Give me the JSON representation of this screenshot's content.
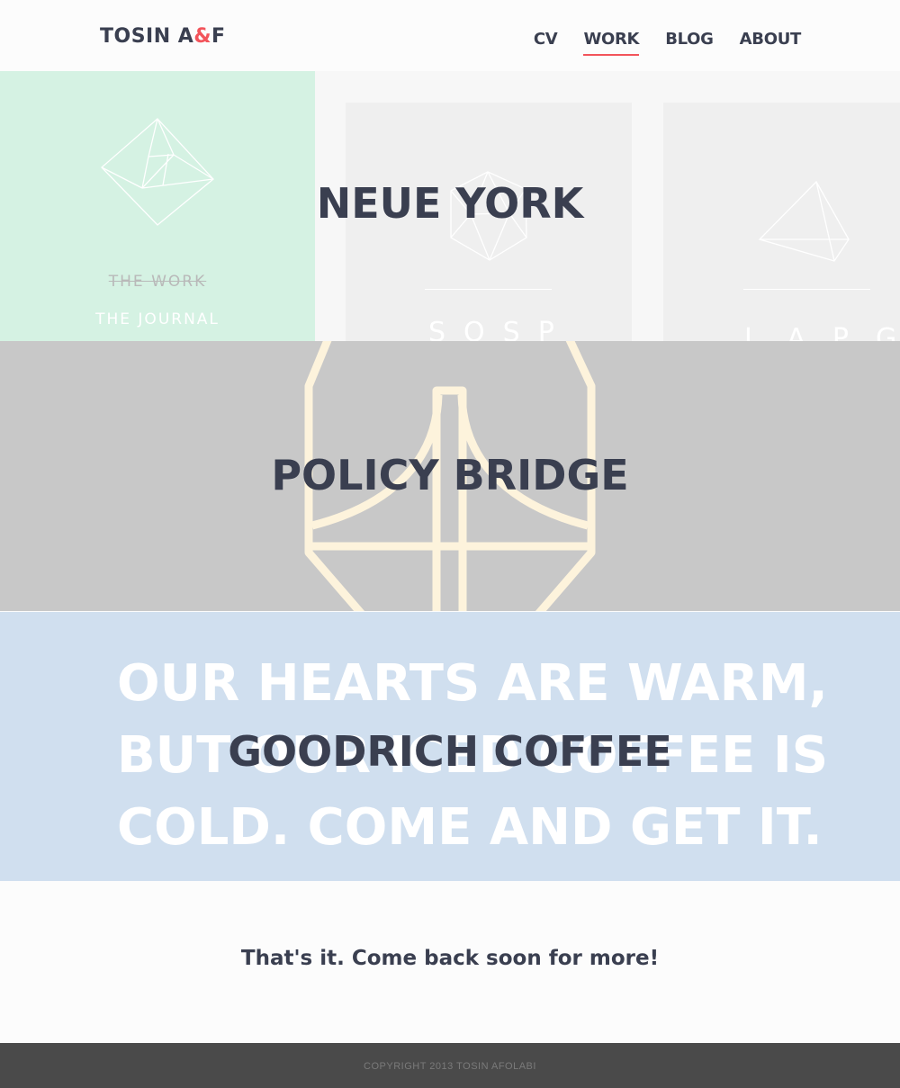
{
  "header": {
    "logo_main": "TOSIN A",
    "logo_amp": "&",
    "logo_end": "F",
    "nav": [
      {
        "label": "CV",
        "active": false
      },
      {
        "label": "WORK",
        "active": true
      },
      {
        "label": "BLOG",
        "active": false
      },
      {
        "label": "ABOUT",
        "active": false
      }
    ]
  },
  "projects": {
    "neue_york": {
      "title": "NEUE YORK",
      "work_label": "THE WORK",
      "journal_label": "THE JOURNAL",
      "card1_letters": "SQSP",
      "card2_letters": "LAPG"
    },
    "policy_bridge": {
      "title": "POLICY BRIDGE"
    },
    "goodrich": {
      "title": "GOODRICH COFFEE",
      "tagline_1": "OUR HEARTS ARE WARM,",
      "tagline_2": "BUT OUR ICED COFFEE IS",
      "tagline_3": "COLD. COME AND GET IT."
    }
  },
  "end_message": "That's it. Come back soon for more!",
  "footer": {
    "copyright": "COPYRIGHT 2013 TOSIN AFOLABI"
  },
  "colors": {
    "accent": "#f2545b",
    "text_dark": "#3a3f50",
    "green_panel": "#d5f2e3",
    "bridge_gray": "#c8c8c8",
    "coffee_blue": "#d0dfef",
    "bridge_outline": "#fdf3dc",
    "footer_bg": "#4a4a4a"
  }
}
